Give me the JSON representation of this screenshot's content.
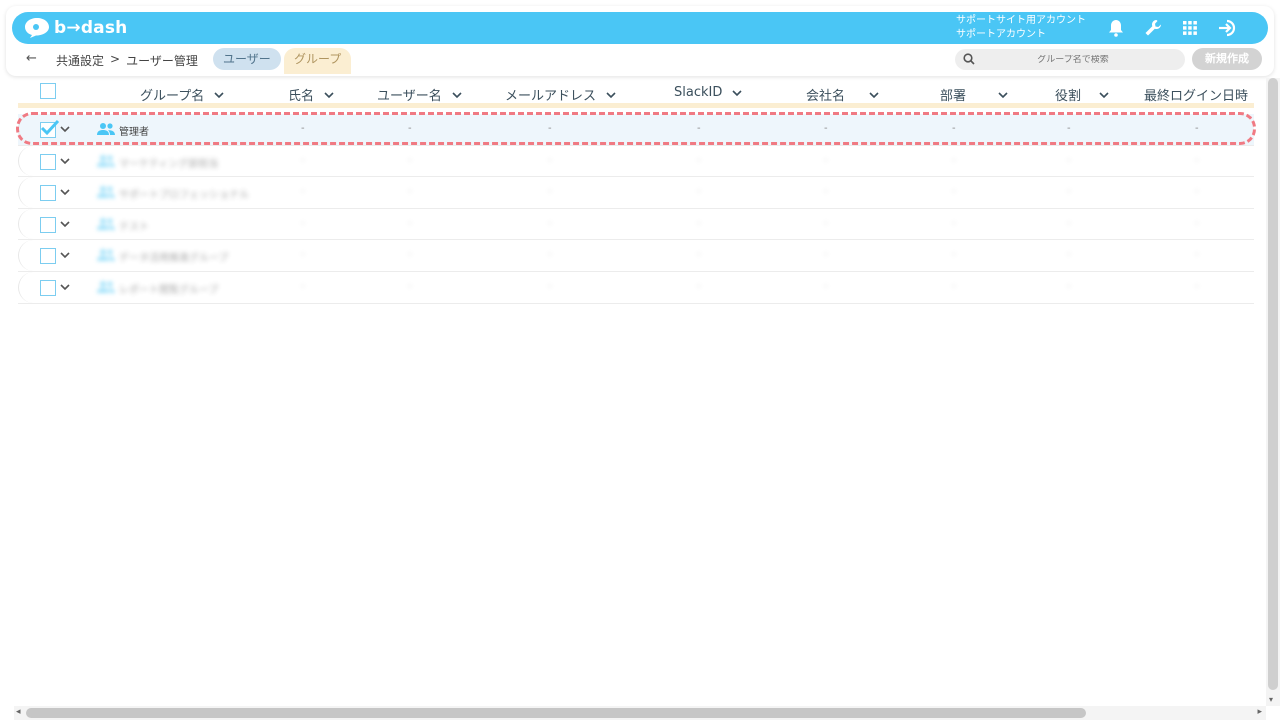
{
  "header": {
    "logo_text": "b→dash",
    "account_line1": "サポートサイト用アカウント",
    "account_line2": "サポートアカウント",
    "icons": [
      "bell-icon",
      "wrench-icon",
      "apps-grid-icon",
      "logout-icon"
    ],
    "color": "#4ac6f5"
  },
  "subnav": {
    "back_label": "←",
    "breadcrumb": [
      "共通設定",
      ">",
      "ユーザー管理"
    ],
    "tabs": [
      {
        "label": "ユーザー",
        "active": false
      },
      {
        "label": "グループ",
        "active": true
      }
    ],
    "search_placeholder": "グループ名で検索",
    "new_button": "新規作成"
  },
  "table": {
    "columns": [
      "グループ名",
      "氏名",
      "ユーザー名",
      "メールアドレス",
      "SlackID",
      "会社名",
      "部署",
      "役割",
      "最終ログイン日時"
    ],
    "rows": [
      {
        "name": "管理者",
        "checked": true,
        "blurred": false,
        "cells": [
          "-",
          "-",
          "-",
          "-",
          "-",
          "-",
          "-",
          "-"
        ]
      },
      {
        "name": "マーケティング部担当",
        "checked": false,
        "blurred": true,
        "cells": [
          "-",
          "-",
          "-",
          "-",
          "-",
          "-",
          "-",
          "-"
        ]
      },
      {
        "name": "サポートプロフェッショナル",
        "checked": false,
        "blurred": true,
        "cells": [
          "-",
          "-",
          "-",
          "-",
          "-",
          "-",
          "-",
          "-"
        ]
      },
      {
        "name": "テスト",
        "checked": false,
        "blurred": true,
        "cells": [
          "-",
          "-",
          "-",
          "-",
          "-",
          "-",
          "-",
          "-"
        ]
      },
      {
        "name": "データ活用推進グループ",
        "checked": false,
        "blurred": true,
        "cells": [
          "-",
          "-",
          "-",
          "-",
          "-",
          "-",
          "-",
          "-"
        ]
      },
      {
        "name": "レポート閲覧グループ",
        "checked": false,
        "blurred": true,
        "cells": [
          "-",
          "-",
          "-",
          "-",
          "-",
          "-",
          "-",
          "-"
        ]
      }
    ]
  },
  "scroll": {
    "left": "◂",
    "right": "▸",
    "down": "▾"
  }
}
